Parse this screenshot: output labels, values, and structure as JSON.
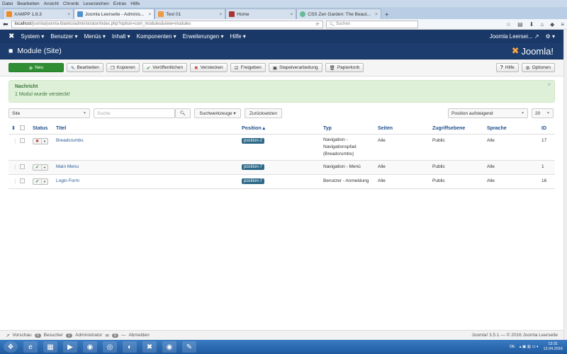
{
  "browser": {
    "menu": [
      "Datei",
      "Bearbeiten",
      "Ansicht",
      "Chronik",
      "Lesezeichen",
      "Extras",
      "Hilfe"
    ],
    "tabs": [
      {
        "label": "XAMPP 1.8.3"
      },
      {
        "label": "Joomla Leerseite - Adminis..."
      },
      {
        "label": "Test 01"
      },
      {
        "label": "Home"
      },
      {
        "label": "CSS Zen Garden: The Beaut..."
      }
    ],
    "url_host": "localhost",
    "url_path": "/joomla/joomla-blanko/administrator/index.php?option=com_modules&view=modules",
    "search_placeholder": "Suchen"
  },
  "nav": {
    "items": [
      "System ▾",
      "Benutzer ▾",
      "Menüs ▾",
      "Inhalt ▾",
      "Komponenten ▾",
      "Erweiterungen ▾",
      "Hilfe ▾"
    ],
    "site": "Joomla Leersei... ↗",
    "settings": "⚙ ▾"
  },
  "header": {
    "title": "Module (Site)",
    "logo": "Joomla!"
  },
  "toolbar": {
    "new": "Neu",
    "edit": "Bearbeiten",
    "copy": "Kopieren",
    "publish": "Veröffentlichen",
    "unpublish": "Verstecken",
    "checkin": "Freigeben",
    "batch": "Stapelverarbeitung",
    "trash": "Papierkorb",
    "help": "Hilfe",
    "options": "Optionen"
  },
  "message": {
    "title": "Nachricht",
    "text": "1 Modul wurde versteckt!"
  },
  "filters": {
    "client": "Site",
    "search_placeholder": "Suche",
    "tools": "Suchwerkzeuge ▾",
    "reset": "Zurücksetzen",
    "ordering": "Position aufsteigend",
    "limit": "20"
  },
  "table": {
    "headers": {
      "status": "Status",
      "title": "Titel",
      "position": "Position ▴",
      "type": "Typ",
      "pages": "Seiten",
      "access": "Zugriffsebene",
      "language": "Sprache",
      "id": "ID"
    },
    "rows": [
      {
        "status": "✖",
        "title": "Breadcrumbs",
        "position": "position-2",
        "type": "Navigation - Navigationspfad (Breadcrumbs)",
        "pages": "Alle",
        "access": "Public",
        "language": "Alle",
        "id": "17"
      },
      {
        "status": "✔",
        "title": "Main Menu",
        "position": "position-7",
        "type": "Navigation - Menü",
        "pages": "Alle",
        "access": "Public",
        "language": "Alle",
        "id": "1"
      },
      {
        "status": "✔",
        "title": "Login Form",
        "position": "position-7",
        "type": "Benutzer - Anmeldung",
        "pages": "Alle",
        "access": "Public",
        "language": "Alle",
        "id": "16"
      }
    ]
  },
  "footer": {
    "preview": "Vorschau",
    "visitors_count": "0",
    "visitors": "Besucher",
    "admins_count": "1",
    "admins": "Administrator",
    "msgs_count": "0",
    "logout": "Abmelden",
    "version": "Joomla! 3.5.1 — © 2016 Joomla Leerseite"
  },
  "taskbar": {
    "lang": "DE",
    "time": "13:31",
    "date": "12.04.2016"
  }
}
